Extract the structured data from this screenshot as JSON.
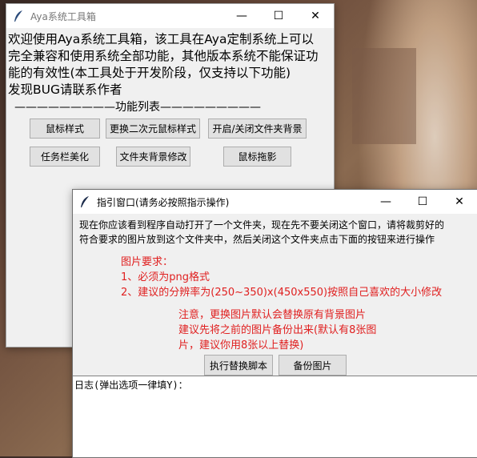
{
  "main_window": {
    "title": "Aya系统工具箱",
    "intro_lines": [
      "欢迎使用Aya系统工具箱，该工具在Aya定制系统上可以",
      "完全兼容和使用系统全部功能，其他版本系统不能保证功",
      "能的有效性(本工具处于开发阶段，仅支持以下功能)",
      "发现BUG请联系作者"
    ],
    "section_title": "—————————功能列表—————————",
    "buttons": {
      "mouse_style": "鼠标样式",
      "anime_cursor": "更换二次元鼠标样式",
      "toggle_folder_bg": "开启/关闭文件夹背景",
      "taskbar": "任务栏美化",
      "folder_bg_edit": "文件夹背景修改",
      "mouse_trail": "鼠标拖影"
    }
  },
  "guide_window": {
    "title": "指引窗口(请务必按照指示操作)",
    "instruction_lines": [
      "现在你应该看到程序自动打开了一个文件夹，现在先不要关闭这个窗口，请将裁剪好的",
      "符合要求的图片放到这个文件夹中，然后关闭这个文件夹点击下面的按钮来进行操作"
    ],
    "requirements": [
      "图片要求：",
      "1、必须为png格式",
      "2、建议的分辨率为(250~350)x(450x550)按照自己喜欢的大小修改"
    ],
    "notice": [
      "注意，更换图片默认会替换原有背景图片",
      "建议先将之前的图片备份出来(默认有8张图",
      "片，建议你用8张以上替换)"
    ],
    "buttons": {
      "run_script": "执行替换脚本",
      "backup": "备份图片"
    },
    "log_text": "日志(弹出选项一律填Y)："
  }
}
